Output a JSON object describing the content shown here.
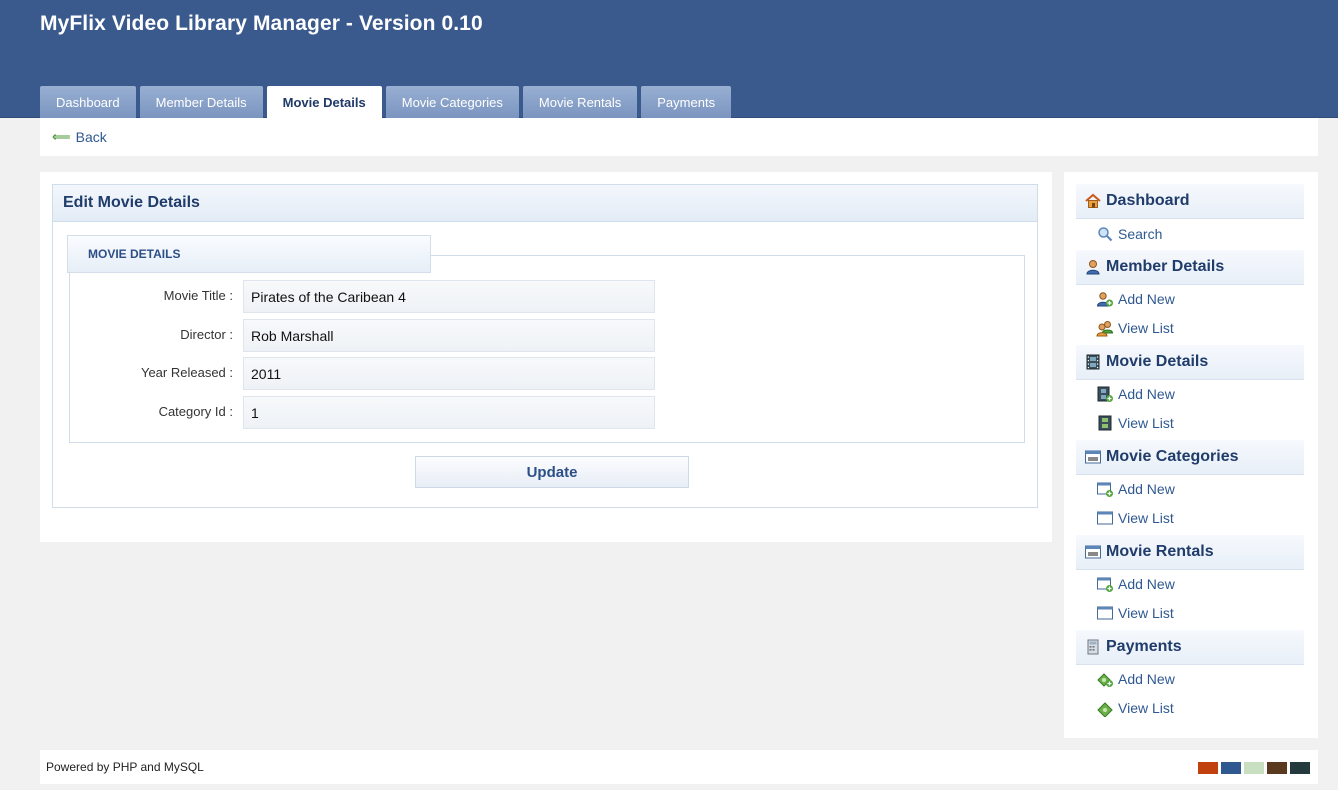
{
  "app_title": "MyFlix Video Library Manager - Version 0.10",
  "tabs": [
    {
      "label": "Dashboard"
    },
    {
      "label": "Member Details"
    },
    {
      "label": "Movie Details"
    },
    {
      "label": "Movie Categories"
    },
    {
      "label": "Movie Rentals"
    },
    {
      "label": "Payments"
    }
  ],
  "active_tab": "Movie Details",
  "back": {
    "label": "Back",
    "icon": "arrow-left-icon"
  },
  "panel": {
    "title": "Edit Movie Details",
    "legend": "MOVIE DETAILS",
    "fields": [
      {
        "label": "Movie Title :",
        "value": "Pirates of the Caribean 4"
      },
      {
        "label": "Director :",
        "value": "Rob Marshall"
      },
      {
        "label": "Year Released :",
        "value": "2011"
      },
      {
        "label": "Category Id :",
        "value": "1"
      }
    ],
    "submit_label": "Update"
  },
  "sidebar": {
    "sections": [
      {
        "title": "Dashboard",
        "icon": "home-icon",
        "links": [
          {
            "label": "Search",
            "icon": "magnifier-icon"
          }
        ]
      },
      {
        "title": "Member Details",
        "icon": "user-icon",
        "links": [
          {
            "label": "Add New",
            "icon": "user-add-icon"
          },
          {
            "label": "View List",
            "icon": "users-icon"
          }
        ]
      },
      {
        "title": "Movie Details",
        "icon": "film-icon",
        "links": [
          {
            "label": "Add New",
            "icon": "film-add-icon"
          },
          {
            "label": "View List",
            "icon": "film-icon"
          }
        ]
      },
      {
        "title": "Movie Categories",
        "icon": "window-icon",
        "links": [
          {
            "label": "Add New",
            "icon": "window-add-icon"
          },
          {
            "label": "View List",
            "icon": "window-icon"
          }
        ]
      },
      {
        "title": "Movie Rentals",
        "icon": "window-icon",
        "links": [
          {
            "label": "Add New",
            "icon": "window-add-icon"
          },
          {
            "label": "View List",
            "icon": "window-icon"
          }
        ]
      },
      {
        "title": "Payments",
        "icon": "calculator-icon",
        "links": [
          {
            "label": "Add New",
            "icon": "money-add-icon"
          },
          {
            "label": "View List",
            "icon": "money-icon"
          }
        ]
      }
    ]
  },
  "footer": {
    "text": "Powered by PHP and MySQL",
    "swatch_colors": [
      "#c0400e",
      "#2f5891",
      "#c9dfc1",
      "#5a3a1e",
      "#24393d"
    ]
  },
  "colors": {
    "header_bg": "#3a5a8e",
    "tab_bg": "#8aa3cb",
    "link": "#2f5891",
    "heading": "#203c6a"
  }
}
